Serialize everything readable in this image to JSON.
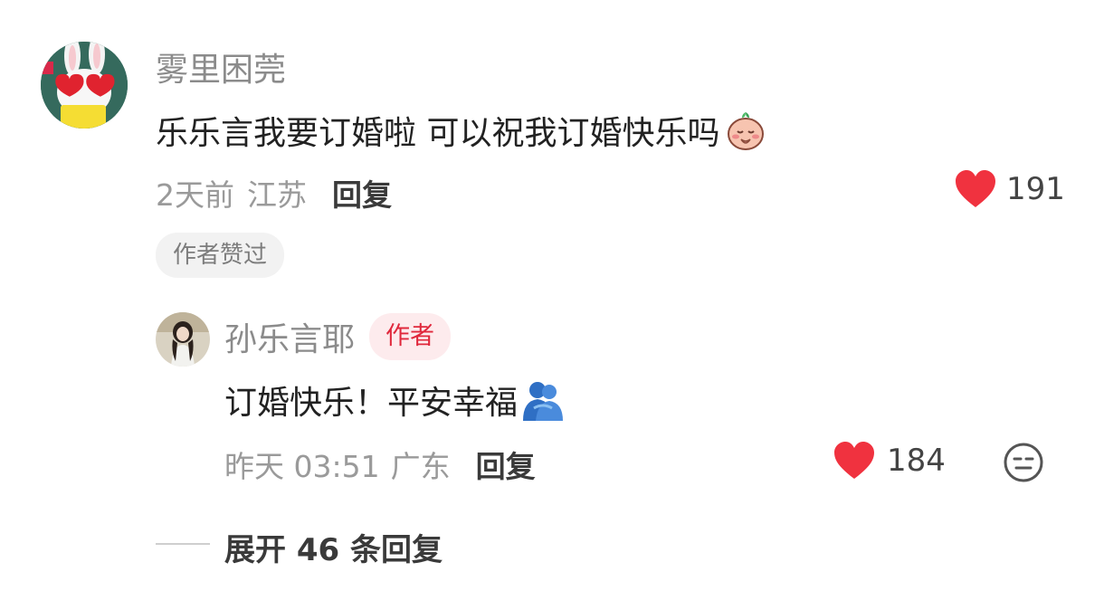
{
  "comment": {
    "username": "雾里困莞",
    "text": "乐乐言我要订婚啦 可以祝我订婚快乐吗",
    "emoji_icon": "cute-praying-character-emoji",
    "time": "2天前",
    "location": "江苏",
    "reply_label": "回复",
    "like_count": "191",
    "author_liked_label": "作者赞过"
  },
  "reply": {
    "username": "孙乐言耶",
    "author_tag": "作者",
    "text": "订婚快乐！平安幸福",
    "emoji_icon": "people-hugging-emoji",
    "time": "昨天 03:51",
    "location": "广东",
    "reply_label": "回复",
    "like_count": "184"
  },
  "expand": {
    "label": "展开 46 条回复"
  },
  "colors": {
    "heart": "#f0323f",
    "author_tag_text": "#e0283c",
    "author_tag_bg": "#fdebed"
  }
}
